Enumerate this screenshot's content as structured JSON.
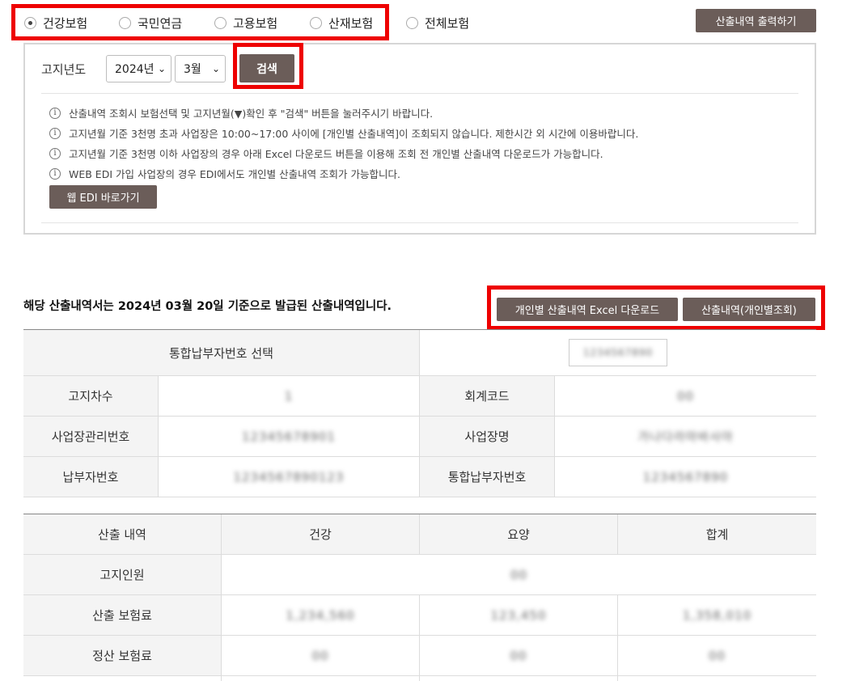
{
  "radios": [
    {
      "label": "건강보험",
      "checked": true
    },
    {
      "label": "국민연금",
      "checked": false
    },
    {
      "label": "고용보험",
      "checked": false
    },
    {
      "label": "산재보험",
      "checked": false
    },
    {
      "label": "전체보험",
      "checked": false
    }
  ],
  "print_button": "산출내역 출력하기",
  "search": {
    "label": "고지년도",
    "year": "2024년",
    "month": "3월",
    "button": "검색",
    "chevron": "⌄"
  },
  "notices": [
    "산출내역 조회시 보험선택 및 고지년월(▼)확인 후 \"검색\" 버튼을 눌러주시기 바랍니다.",
    "고지년월 기준 3천명 초과 사업장은 10:00~17:00 사이에 [개인별 산출내역]이 조회되지 않습니다. 제한시간 외 시간에 이용바랍니다.",
    "고지년월 기준 3천명 이하 사업장의 경우 아래 Excel 다운로드 버튼을 이용해 조회 전 개인별 산출내역 다운로드가 가능합니다.",
    "WEB EDI 가입 사업장의 경우 EDI에서도 개인별 산출내역 조회가 가능합니다."
  ],
  "edi_button": "웹 EDI 바로가기",
  "issued_text": "해당 산출내역서는 2024년 03월 20일 기준으로 발급된 산출내역입니다.",
  "excel_button": "개인별 산출내역 Excel 다운로드",
  "personal_button": "산출내역(개인별조회)",
  "info_table": {
    "select_label": "통합납부자번호 선택",
    "select_value": "1234567890",
    "rows": [
      {
        "l1": "고지차수",
        "v1": "1",
        "l2": "회계코드",
        "v2": "00"
      },
      {
        "l1": "사업장관리번호",
        "v1": "12345678901",
        "l2": "사업장명",
        "v2": "가나다라마바사아"
      },
      {
        "l1": "납부자번호",
        "v1": "1234567890123",
        "l2": "통합납부자번호",
        "v2": "1234567890"
      }
    ]
  },
  "calc_table": {
    "headers": [
      "산출 내역",
      "건강",
      "요양",
      "합계"
    ],
    "rows": [
      {
        "label": "고지인원",
        "merged": "00"
      },
      {
        "label": "산출 보험료",
        "c1": "1,234,560",
        "c2": "123,450",
        "c3": "1,358,010"
      },
      {
        "label": "정산 보험료",
        "c1": "00",
        "c2": "00",
        "c3": "00"
      }
    ]
  },
  "colors": {
    "button_bg": "#6b5d59",
    "highlight": "#ee0000"
  }
}
